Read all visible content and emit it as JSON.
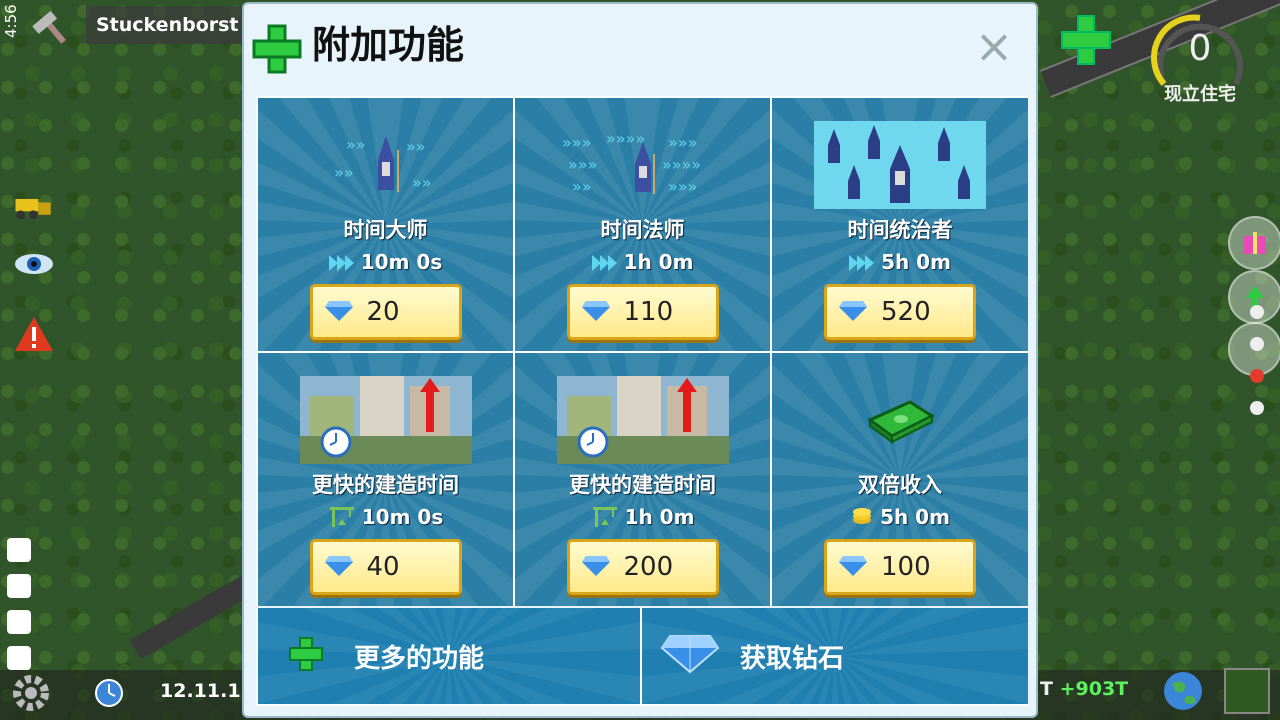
{
  "status": {
    "time": "4:56"
  },
  "hud": {
    "city_name": "Stuckenborst",
    "population_value": "0",
    "population_label": "现立住宅",
    "date": "12.11.1",
    "income_prefix": "T",
    "income": "+903T"
  },
  "dialog": {
    "title": "附加功能",
    "close": "×",
    "items": [
      {
        "name": "时间大师",
        "duration": "10m 0s",
        "price": "20",
        "duration_icon": "fast-forward-icon",
        "image": "wizard-icon"
      },
      {
        "name": "时间法师",
        "duration": "1h 0m",
        "price": "110",
        "duration_icon": "fast-forward-icon",
        "image": "wizard-icon"
      },
      {
        "name": "时间统治者",
        "duration": "5h 0m",
        "price": "520",
        "duration_icon": "fast-forward-icon",
        "image": "wizard-icon"
      },
      {
        "name": "更快的建造时间",
        "duration": "10m 0s",
        "price": "40",
        "duration_icon": "crane-icon",
        "image": "city-arrow-icon"
      },
      {
        "name": "更快的建造时间",
        "duration": "1h 0m",
        "price": "200",
        "duration_icon": "crane-icon",
        "image": "city-arrow-icon"
      },
      {
        "name": "双倍收入",
        "duration": "5h 0m",
        "price": "100",
        "duration_icon": "coin-icon",
        "image": "money-icon"
      }
    ],
    "more_features": "更多的功能",
    "get_diamonds": "获取钻石"
  },
  "colors": {
    "tile": "#2b7fa6",
    "price_bg": "#ffe98a",
    "accent_green": "#2ecc40",
    "diamond": "#3a8fe8"
  }
}
